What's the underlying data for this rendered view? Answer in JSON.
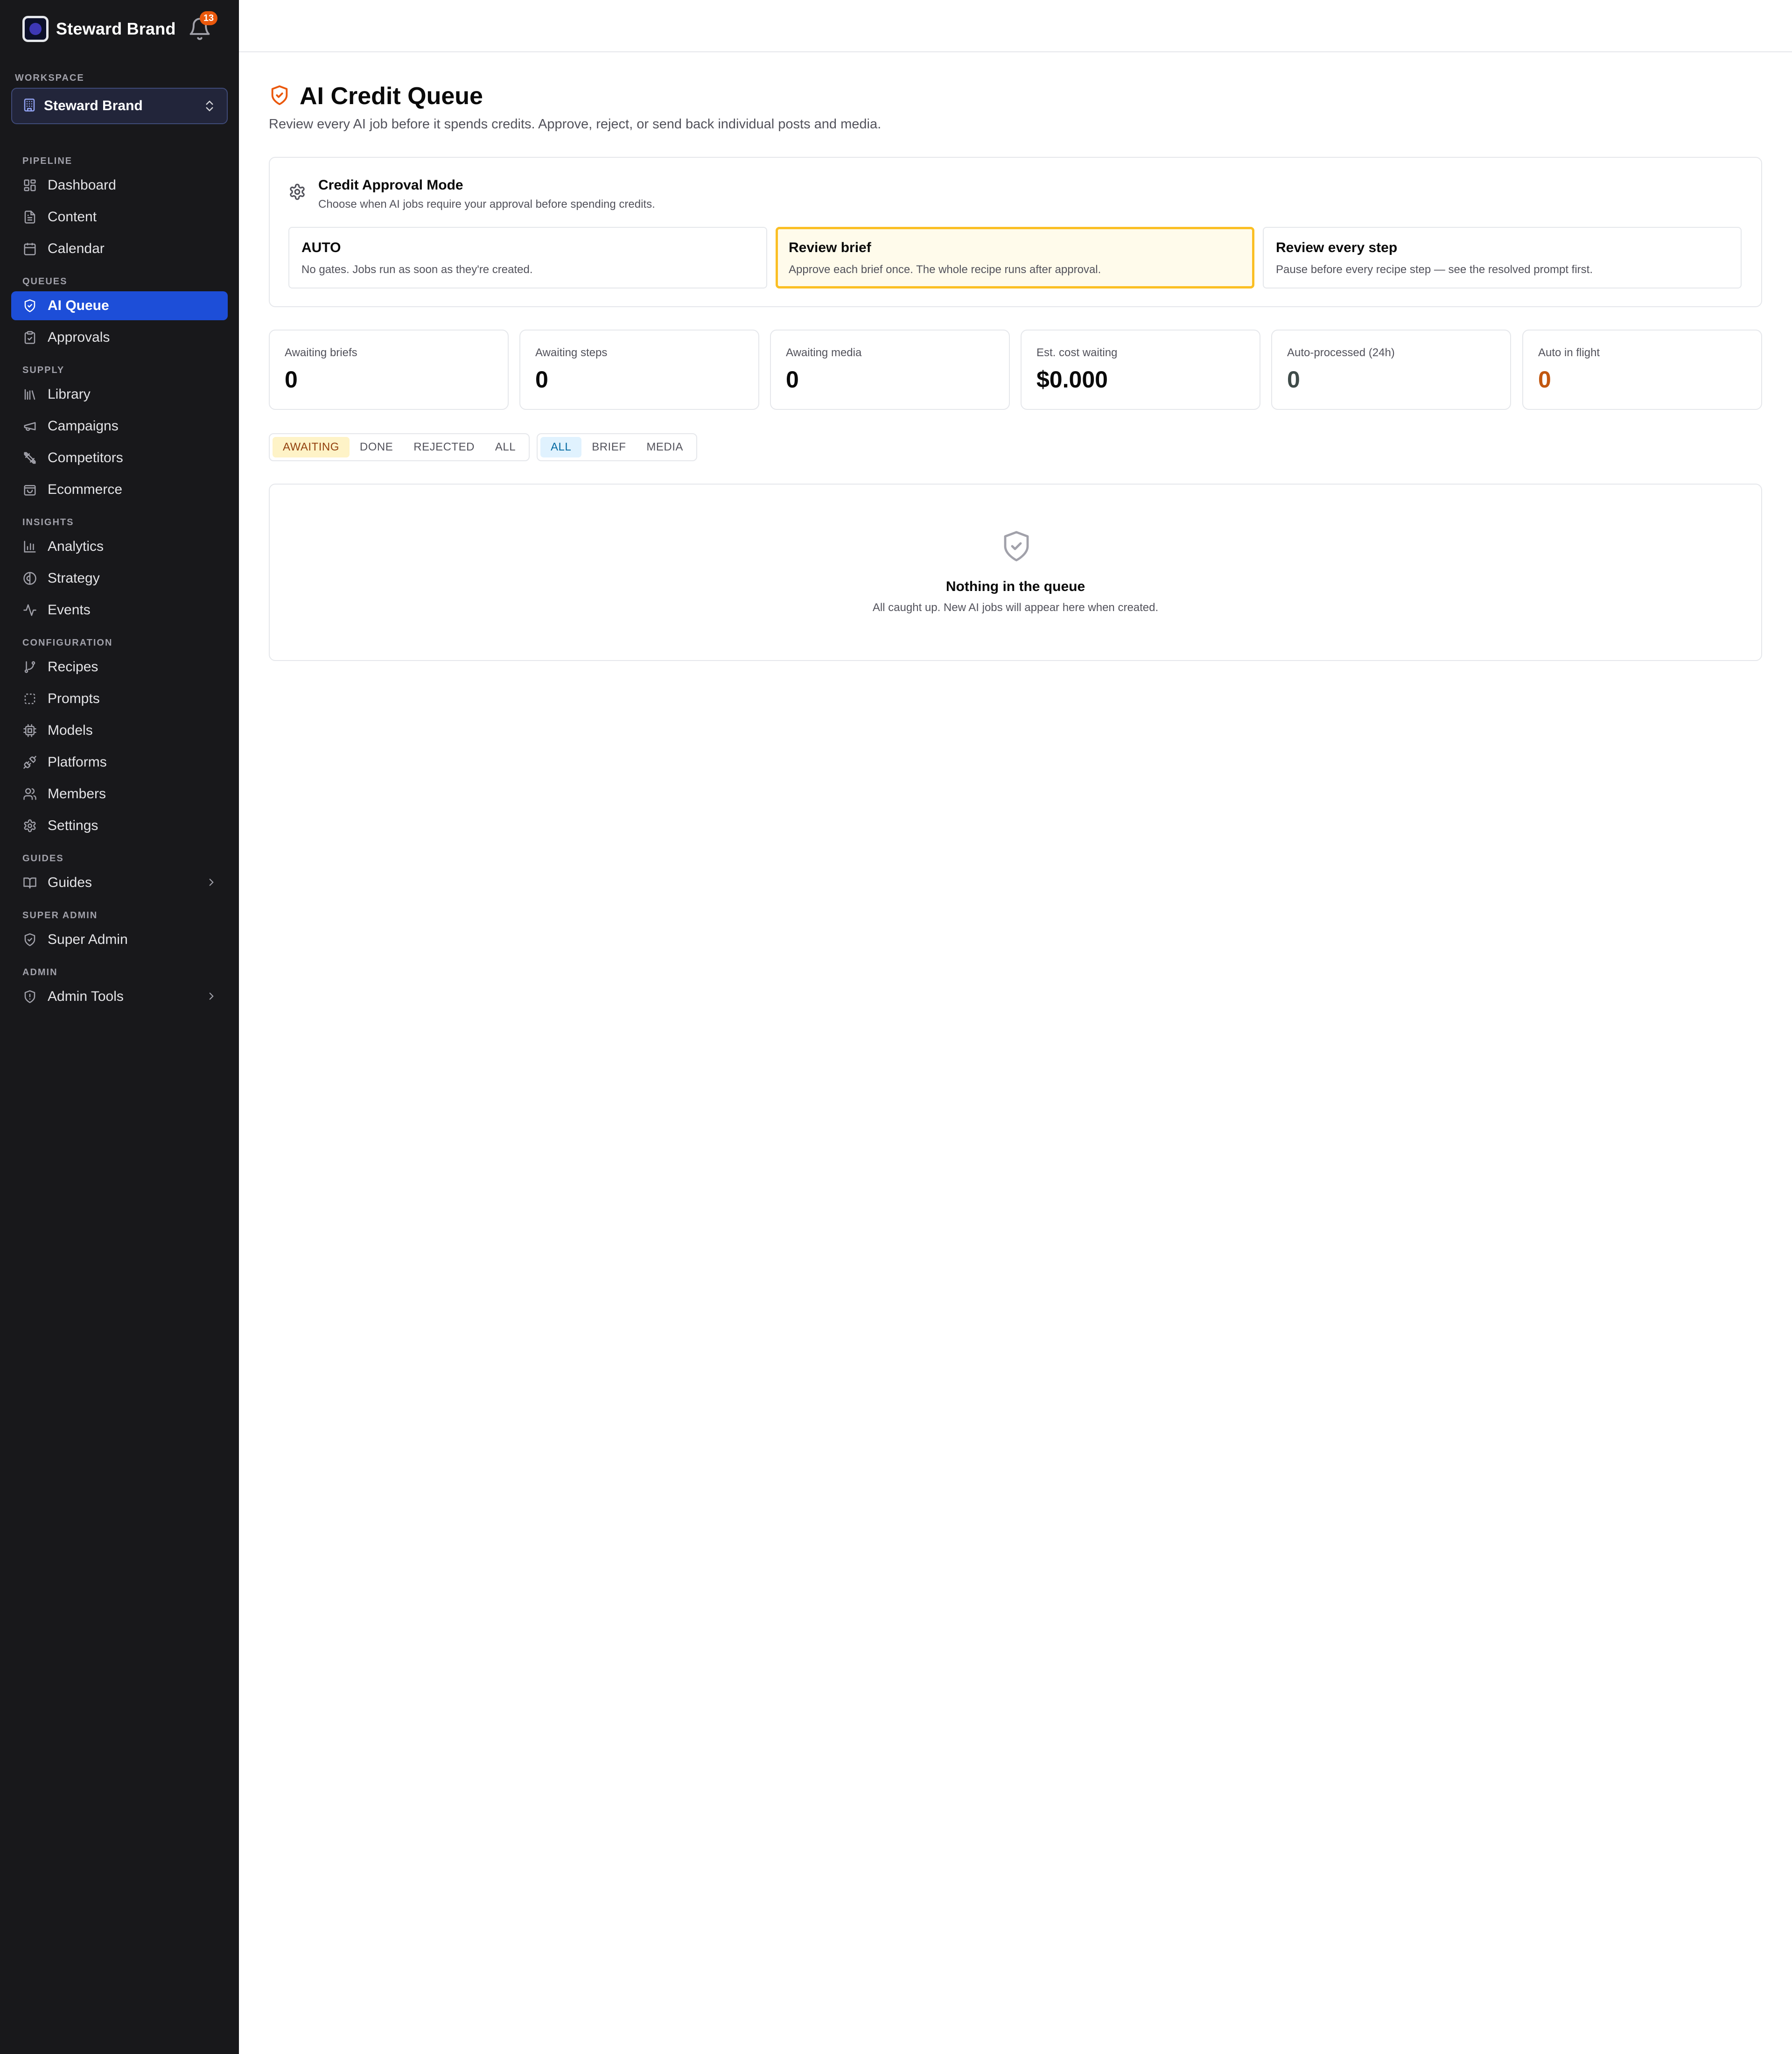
{
  "brand": {
    "name": "Steward Brand",
    "notification_count": "13"
  },
  "workspace": {
    "label": "WORKSPACE",
    "current": "Steward Brand"
  },
  "sidebar": {
    "sections": [
      {
        "label": "PIPELINE"
      },
      {
        "label": "QUEUES"
      },
      {
        "label": "SUPPLY"
      },
      {
        "label": "INSIGHTS"
      },
      {
        "label": "CONFIGURATION"
      },
      {
        "label": "GUIDES"
      },
      {
        "label": "SUPER ADMIN"
      },
      {
        "label": "ADMIN"
      }
    ],
    "items": [
      {
        "label": "Dashboard",
        "icon": "dashboard-icon"
      },
      {
        "label": "Content",
        "icon": "file-icon"
      },
      {
        "label": "Calendar",
        "icon": "calendar-icon"
      },
      {
        "label": "AI Queue",
        "icon": "shield-check-icon",
        "active": true
      },
      {
        "label": "Approvals",
        "icon": "clipboard-check-icon"
      },
      {
        "label": "Library",
        "icon": "library-icon"
      },
      {
        "label": "Campaigns",
        "icon": "megaphone-icon"
      },
      {
        "label": "Competitors",
        "icon": "swords-icon"
      },
      {
        "label": "Ecommerce",
        "icon": "shopping-bag-icon"
      },
      {
        "label": "Analytics",
        "icon": "bar-chart-icon"
      },
      {
        "label": "Strategy",
        "icon": "strategy-icon"
      },
      {
        "label": "Events",
        "icon": "activity-icon"
      },
      {
        "label": "Recipes",
        "icon": "git-branch-icon"
      },
      {
        "label": "Prompts",
        "icon": "frame-icon"
      },
      {
        "label": "Models",
        "icon": "cpu-icon"
      },
      {
        "label": "Platforms",
        "icon": "plug-icon"
      },
      {
        "label": "Members",
        "icon": "users-icon"
      },
      {
        "label": "Settings",
        "icon": "gear-icon"
      },
      {
        "label": "Guides",
        "icon": "book-icon"
      },
      {
        "label": "Super Admin",
        "icon": "shield-icon"
      },
      {
        "label": "Admin Tools",
        "icon": "shield-alert-icon"
      }
    ]
  },
  "page": {
    "title": "AI Credit Queue",
    "subtitle": "Review every AI job before it spends credits. Approve, reject, or send back individual posts and media."
  },
  "approval_mode": {
    "title": "Credit Approval Mode",
    "subtitle": "Choose when AI jobs require your approval before spending credits.",
    "options": [
      {
        "title": "AUTO",
        "desc": "No gates. Jobs run as soon as they're created."
      },
      {
        "title": "Review brief",
        "desc": "Approve each brief once. The whole recipe runs after approval.",
        "selected": true
      },
      {
        "title": "Review every step",
        "desc": "Pause before every recipe step — see the resolved prompt first."
      }
    ]
  },
  "stats": [
    {
      "label": "Awaiting briefs",
      "value": "0"
    },
    {
      "label": "Awaiting steps",
      "value": "0"
    },
    {
      "label": "Awaiting media",
      "value": "0"
    },
    {
      "label": "Est. cost waiting",
      "value": "$0.000"
    },
    {
      "label": "Auto-processed (24h)",
      "value": "0"
    },
    {
      "label": "Auto in flight",
      "value": "0"
    }
  ],
  "filters": {
    "status": [
      "AWAITING",
      "DONE",
      "REJECTED",
      "ALL"
    ],
    "status_selected": "AWAITING",
    "kind": [
      "ALL",
      "BRIEF",
      "MEDIA"
    ],
    "kind_selected": "ALL"
  },
  "empty_state": {
    "title": "Nothing in the queue",
    "desc": "All caught up. New AI jobs will appear here when created."
  },
  "colors": {
    "accent": "#1d4ed8",
    "sidebar_bg": "#18181b",
    "warning": "#fbbf24",
    "brand_orange": "#ea580c"
  }
}
